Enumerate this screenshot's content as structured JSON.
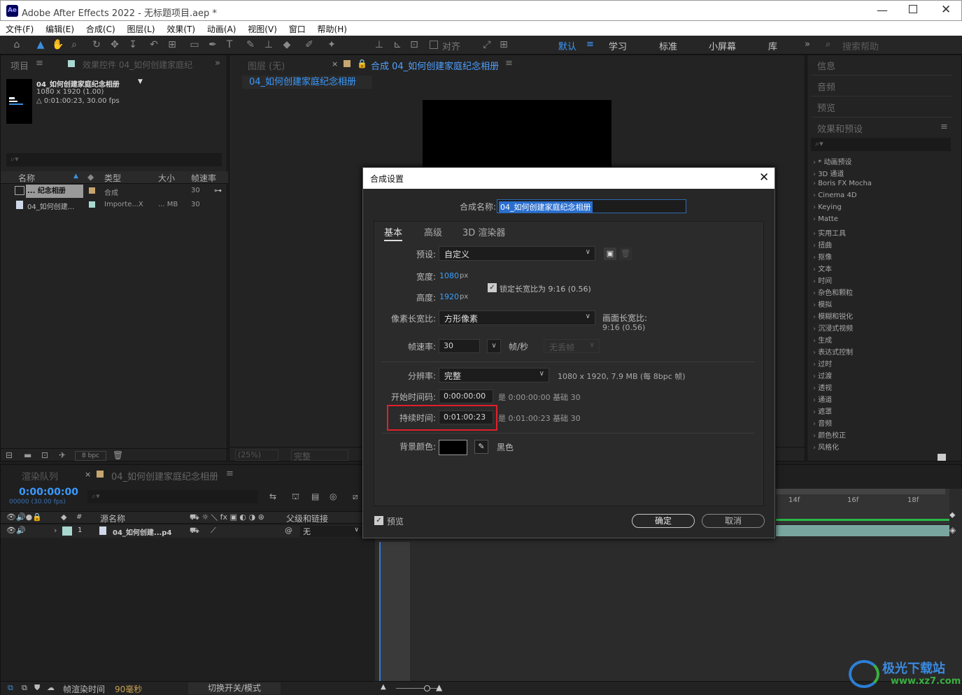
{
  "app": {
    "title": "Adobe After Effects 2022 - 无标题项目.aep *",
    "logo": "Ae"
  },
  "menu": [
    "文件(F)",
    "编辑(E)",
    "合成(C)",
    "图层(L)",
    "效果(T)",
    "动画(A)",
    "视图(V)",
    "窗口",
    "帮助(H)"
  ],
  "toolbar": {
    "snap_label": "对齐",
    "workspaces": [
      "默认",
      "学习",
      "标准",
      "小屏幕",
      "库"
    ],
    "search_placeholder": "搜索帮助"
  },
  "project": {
    "tab": "项目",
    "fx_tab": "效果控件 04_如何创建家庭纪",
    "comp_name": "04_如何创建家庭纪念相册",
    "comp_size": "1080 x 1920 (1.00)",
    "comp_duration": "△ 0:01:00:23, 30.00 fps",
    "columns": [
      "名称",
      "类型",
      "大小",
      "帧速率"
    ],
    "rows": [
      {
        "name": "... 纪念相册",
        "type": "合成",
        "size": "",
        "fps": "30"
      },
      {
        "name": "04_如何创建...",
        "type": "Importe...X",
        "size": "... MB",
        "fps": "30"
      }
    ],
    "bpc": "8 bpc"
  },
  "viewer": {
    "layer_tab": "图层 (无)",
    "comp_tab": "合成 04_如何创建家庭纪念相册",
    "comp_subtab": "04_如何创建家庭纪念相册",
    "zoom": "(25%)",
    "quality": "完整"
  },
  "right_panels": {
    "tabs": [
      "信息",
      "音频",
      "预览",
      "效果和预设"
    ],
    "fx_items": [
      "* 动画预设",
      "3D 通道",
      "Boris FX Mocha",
      "Cinema 4D",
      "Keying",
      "Matte",
      "实用工具",
      "扭曲",
      "抠像",
      "文本",
      "时间",
      "杂色和颗粒",
      "模拟",
      "模糊和锐化",
      "沉浸式视频",
      "生成",
      "表达式控制",
      "过时",
      "过渡",
      "透视",
      "通道",
      "遮罩",
      "音频",
      "颜色校正",
      "风格化"
    ]
  },
  "timeline": {
    "render_tab": "渲染队列",
    "comp_tab": "04_如何创建家庭纪念相册",
    "timecode": "0:00:00:00",
    "frames": "00000 (30.00 fps)",
    "columns": {
      "source": "源名称",
      "parent": "父级和链接"
    },
    "layer": {
      "num": "1",
      "name": "04_如何创建...p4",
      "parent": "无"
    },
    "ruler": [
      "14f",
      "16f",
      "18f"
    ],
    "footer_label": "帧渲染时间",
    "footer_value": "90毫秒",
    "switch_label": "切换开关/模式"
  },
  "dialog": {
    "title": "合成设置",
    "name_label": "合成名称:",
    "name_value": "04_如何创建家庭纪念相册",
    "tabs": [
      "基本",
      "高级",
      "3D 渲染器"
    ],
    "preset_label": "预设:",
    "preset_value": "自定义",
    "width_label": "宽度:",
    "width_value": "1080",
    "px": "px",
    "height_label": "高度:",
    "height_value": "1920",
    "lock_label": "锁定长宽比为 9:16 (0.56)",
    "pixel_aspect_label": "像素长宽比:",
    "pixel_aspect_value": "方形像素",
    "frame_aspect_label": "画面长宽比:",
    "frame_aspect_value": "9:16 (0.56)",
    "framerate_label": "帧速率:",
    "framerate_value": "30",
    "fps_unit": "帧/秒",
    "dropframe": "无丢帧",
    "resolution_label": "分辨率:",
    "resolution_value": "完整",
    "resolution_info": "1080 x 1920, 7.9 MB (每 8bpc 帧)",
    "start_label": "开始时间码:",
    "start_value": "0:00:00:00",
    "start_info": "是 0:00:00:00  基础 30",
    "duration_label": "持续时间:",
    "duration_value": "0:01:00:23",
    "duration_info": "是 0:01:00:23  基础 30",
    "bg_label": "背景颜色:",
    "bg_name": "黑色",
    "preview_label": "预览",
    "ok": "确定",
    "cancel": "取消"
  },
  "watermark": {
    "title": "极光下载站",
    "url": "www.xz7.com"
  }
}
